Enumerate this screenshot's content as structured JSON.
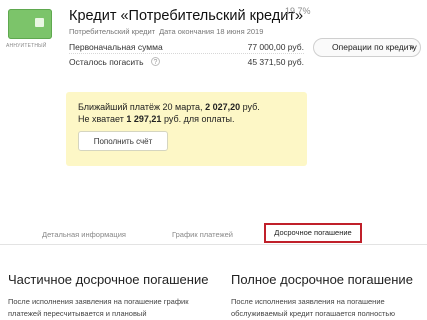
{
  "header": {
    "card_type": "АННУИТЕТНЫЙ",
    "title": "Кредит «Потребительский кредит»",
    "rate": "19.7%",
    "subtitle_name": "Потребительский кредит",
    "subtitle_end": "Дата окончания 18 июня 2019"
  },
  "summary": {
    "initial_label": "Первоначальная сумма",
    "initial_value": "77 000,00 руб.",
    "remaining_label": "Осталось погасить",
    "remaining_value": "45 371,50 руб.",
    "info_symbol": "?"
  },
  "ops_button": {
    "label": "Операции по кредиту",
    "chevron": "▾"
  },
  "notice": {
    "line1_prefix": "Ближайший платёж 20 марта,",
    "line1_amount": "2 027,20",
    "line1_suffix": "руб.",
    "line2_prefix": "Не хватает",
    "line2_amount": "1 297,21",
    "line2_suffix": "руб. для оплаты.",
    "button_label": "Пополнить счёт"
  },
  "tabs": {
    "details": "Детальная информация",
    "schedule": "График платежей",
    "early": "Досрочное погашение",
    "active": "early"
  },
  "columns": {
    "partial_title": "Частичное досрочное погашение",
    "partial_line1": "После исполнения заявления на погашение график",
    "partial_line2": "платежей пересчитывается и плановый",
    "full_title": "Полное досрочное погашение",
    "full_line1": "После исполнения заявления на погашение",
    "full_line2": "обслуживаемый кредит погашается полностью"
  },
  "colors": {
    "card_green": "#7cc46a",
    "notice_yellow": "#fdf7c6",
    "highlight_red": "#c0202a"
  }
}
